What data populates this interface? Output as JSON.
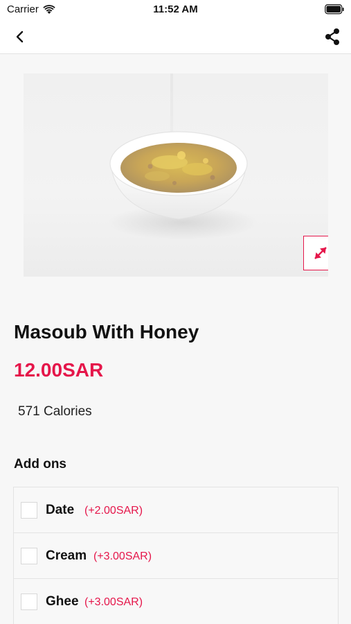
{
  "status_bar": {
    "carrier": "Carrier",
    "time": "11:52 AM"
  },
  "nav": {
    "back_icon": "chevron-left-icon",
    "share_icon": "share-icon"
  },
  "product": {
    "name": "Masoub With Honey",
    "price": "12.00SAR",
    "calories": "571 Calories",
    "expand_icon": "expand-icon"
  },
  "addons": {
    "heading": "Add ons",
    "items": [
      {
        "name": "Date",
        "price": "(+2.00SAR)",
        "checked": false
      },
      {
        "name": "Cream",
        "price": "(+3.00SAR)",
        "checked": false
      },
      {
        "name": "Ghee",
        "price": "(+3.00SAR)",
        "checked": false
      }
    ]
  },
  "colors": {
    "accent": "#e5164a",
    "background": "#f7f7f7",
    "text": "#111111"
  }
}
